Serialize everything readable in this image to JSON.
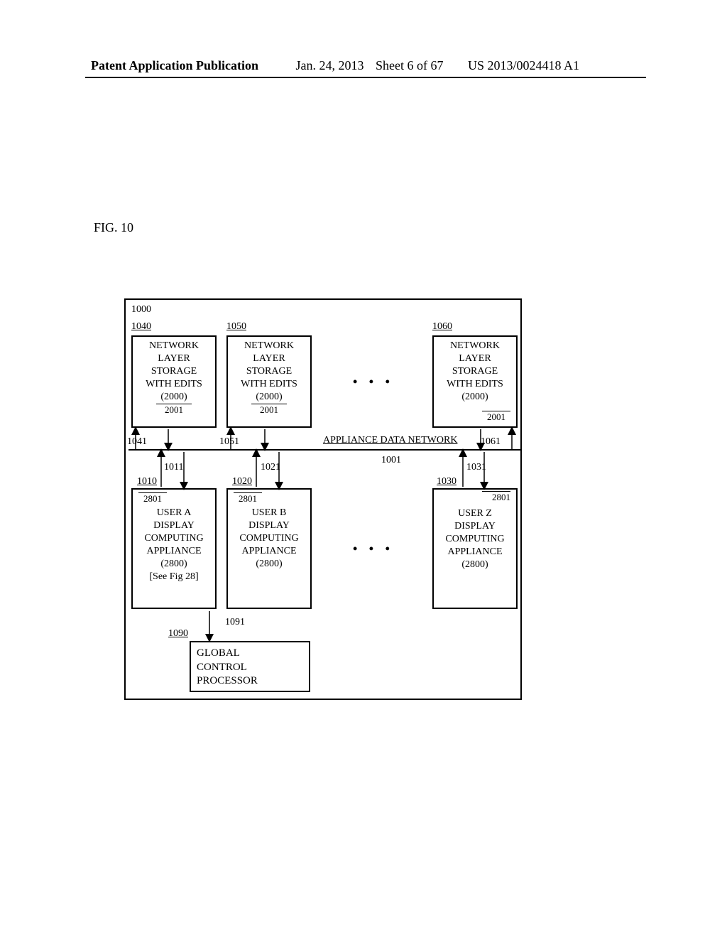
{
  "header": {
    "publication_label": "Patent Application Publication",
    "date": "Jan. 24, 2013",
    "sheet": "Sheet 6 of 67",
    "pub_number": "US 2013/0024418 A1"
  },
  "figure_label": "FIG. 10",
  "outer_ref": "1000",
  "network_line": "APPLIANCE DATA NETWORK",
  "network_ref_near_line": "1001",
  "dots": "• • •",
  "top_boxes": [
    {
      "ref": "1040",
      "lines": [
        "NETWORK",
        "LAYER",
        "STORAGE",
        "WITH EDITS",
        "(2000)"
      ],
      "sub": "2001",
      "arrow_ref": "1041"
    },
    {
      "ref": "1050",
      "lines": [
        "NETWORK",
        "LAYER",
        "STORAGE",
        "WITH EDITS",
        "(2000)"
      ],
      "sub": "2001",
      "arrow_ref": "1051"
    },
    {
      "ref": "1060",
      "lines": [
        "NETWORK",
        "LAYER",
        "STORAGE",
        "WITH EDITS",
        "(2000)"
      ],
      "sub": "2001",
      "arrow_ref": "1061"
    }
  ],
  "mid_arrows": [
    {
      "out": "1011",
      "in": "1010"
    },
    {
      "out": "1021",
      "in": "1020"
    },
    {
      "out": "1031",
      "in": "1030"
    }
  ],
  "bottom_boxes": [
    {
      "sub": "2801",
      "lines": [
        "USER A",
        "DISPLAY",
        "COMPUTING",
        "APPLIANCE",
        "(2800)",
        "[See Fig 28]"
      ]
    },
    {
      "sub": "2801",
      "lines": [
        "USER B",
        "DISPLAY",
        "COMPUTING",
        "APPLIANCE",
        "(2800)"
      ]
    },
    {
      "sub": "2801",
      "lines": [
        "USER Z",
        "DISPLAY",
        "COMPUTING",
        "APPLIANCE",
        "(2800)"
      ]
    }
  ],
  "gcp": {
    "ref": "1090",
    "arrow_ref": "1091",
    "lines": [
      "GLOBAL",
      "CONTROL",
      "PROCESSOR"
    ]
  }
}
